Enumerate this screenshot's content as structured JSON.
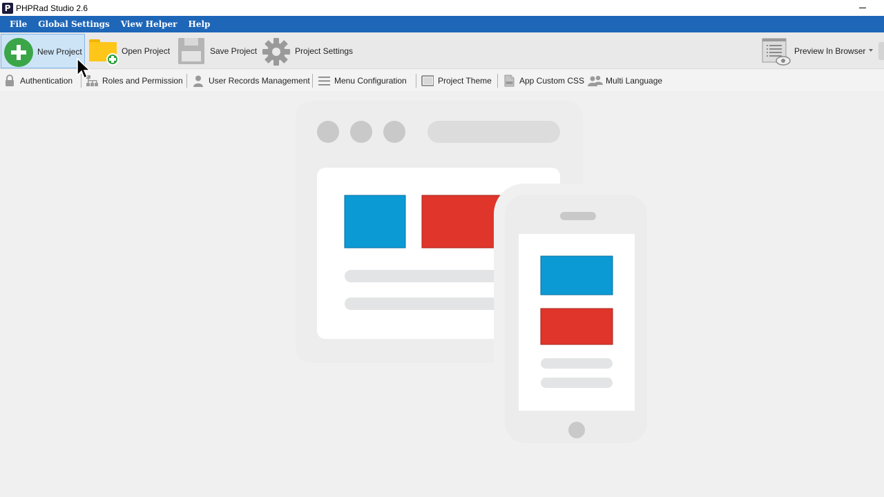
{
  "window": {
    "title": "PHPRad Studio 2.6",
    "logo_letter": "P"
  },
  "menubar": {
    "items": [
      "File",
      "Global Settings",
      "View Helper",
      "Help"
    ]
  },
  "toolbar": {
    "new_project": "New Project",
    "open_project": "Open Project",
    "save_project": "Save Project",
    "project_settings": "Project Settings",
    "preview_in_browser": "Preview In Browser"
  },
  "toolbar2": {
    "authentication": "Authentication",
    "roles_and_permission": "Roles and Permission",
    "user_records_management": "User Records Management",
    "menu_configuration": "Menu Configuration",
    "project_theme": "Project Theme",
    "app_custom_css": "App Custom CSS",
    "multi_language": "Multi Language"
  },
  "colors": {
    "menubar": "#1e66b8",
    "accent_blue": "#0b9ad4",
    "accent_red": "#e0352b",
    "new_project_green": "#3aa648",
    "folder_yellow": "#ffc61a"
  }
}
